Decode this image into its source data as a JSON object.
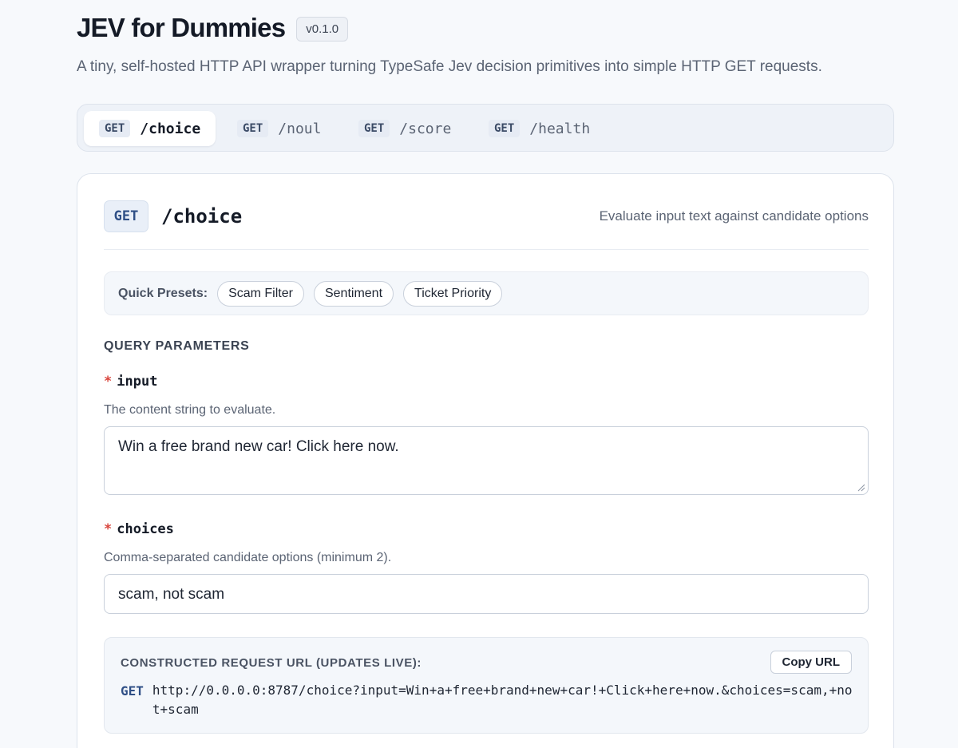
{
  "header": {
    "title": "JEV for Dummies",
    "version": "v0.1.0",
    "subtitle": "A tiny, self-hosted HTTP API wrapper turning TypeSafe Jev decision primitives into simple HTTP GET requests."
  },
  "tabs": [
    {
      "method": "GET",
      "path": "/choice",
      "active": true
    },
    {
      "method": "GET",
      "path": "/noul",
      "active": false
    },
    {
      "method": "GET",
      "path": "/score",
      "active": false
    },
    {
      "method": "GET",
      "path": "/health",
      "active": false
    }
  ],
  "endpoint": {
    "method": "GET",
    "path": "/choice",
    "description": "Evaluate input text against candidate options"
  },
  "presets": {
    "label": "Quick Presets:",
    "items": [
      "Scam Filter",
      "Sentiment",
      "Ticket Priority"
    ]
  },
  "params": {
    "section_title": "QUERY PARAMETERS",
    "required_marker": "*",
    "input": {
      "name": "input",
      "description": "The content string to evaluate.",
      "value": "Win a free brand new car! Click here now."
    },
    "choices": {
      "name": "choices",
      "description": "Comma-separated candidate options (minimum 2).",
      "value": "scam, not scam"
    }
  },
  "request_url": {
    "label": "CONSTRUCTED REQUEST URL (UPDATES LIVE):",
    "copy_label": "Copy URL",
    "method": "GET",
    "url": "http://0.0.0.0:8787/choice?input=Win+a+free+brand+new+car!+Click+here+now.&choices=scam,+not+scam"
  },
  "colors": {
    "background": "#f7f9fc",
    "accent": "#2f4f86",
    "required": "#d9453d"
  }
}
